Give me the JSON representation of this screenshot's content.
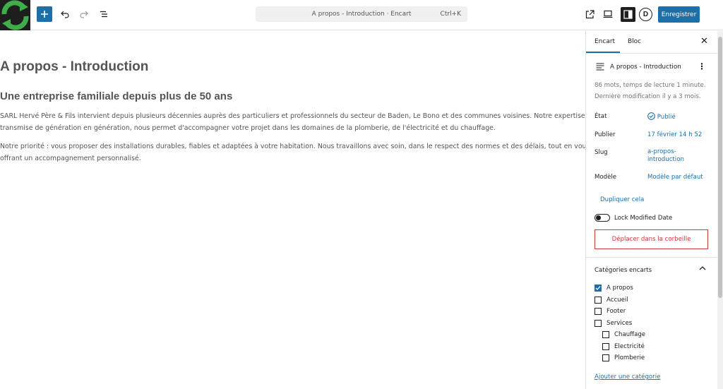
{
  "topbar": {
    "command_title": "A propos - Introduction · Encart",
    "command_shortcut": "Ctrl+K",
    "save_label": "Enregistrer",
    "avatar_letter": "D"
  },
  "post": {
    "title": "A propos - Introduction",
    "subtitle": "Une entreprise familiale depuis plus de 50 ans",
    "paragraphs": [
      "SARL Hervé Père & Fils intervient depuis plusieurs décennies auprès des particuliers et professionnels du secteur de Baden, Le Bono et des communes voisines. Notre expertise,",
      "transmise de génération en génération, nous permet d'accompagner votre projet dans les domaines de la plomberie, de l'électricité et du chauffage.",
      "Notre priorité : vous proposer des installations durables, fiables et adaptées à votre habitation. Nous travaillons avec soin, dans le respect des normes et des délais, tout en vous",
      "offrant un accompagnement personnalisé."
    ]
  },
  "sidebar": {
    "tabs": [
      "Encart",
      "Bloc"
    ],
    "doc_title": "A propos - Introduction",
    "meta_line1": "86 mots, temps de lecture 1 minute.",
    "meta_line2": "Dernière modification il y a 3 mois.",
    "status_label": "État",
    "status_value": "Publié",
    "publish_label": "Publier",
    "publish_value": "17 février 14 h 52",
    "slug_label": "Slug",
    "slug_value_1": "a-propos-",
    "slug_value_2": "introduction",
    "template_label": "Modèle",
    "template_value": "Modèle par défaut",
    "duplicate_label": "Dupliquer cela",
    "lock_label": "Lock Modified Date",
    "trash_label": "Déplacer dans la corbeille",
    "categories_title": "Catégories encarts",
    "categories": [
      {
        "label": "A propos",
        "checked": true
      },
      {
        "label": "Accueil",
        "checked": false
      },
      {
        "label": "Footer",
        "checked": false
      },
      {
        "label": "Services",
        "checked": false
      },
      {
        "label": "Chauffage",
        "checked": false
      },
      {
        "label": "Electricité",
        "checked": false
      },
      {
        "label": "Plomberie",
        "checked": false
      }
    ],
    "add_category_label": "Ajouter une catégorie"
  },
  "colors": {
    "accent": "#1d6fa8",
    "danger": "#cc3b3b",
    "logo_green": "#3fae49"
  }
}
